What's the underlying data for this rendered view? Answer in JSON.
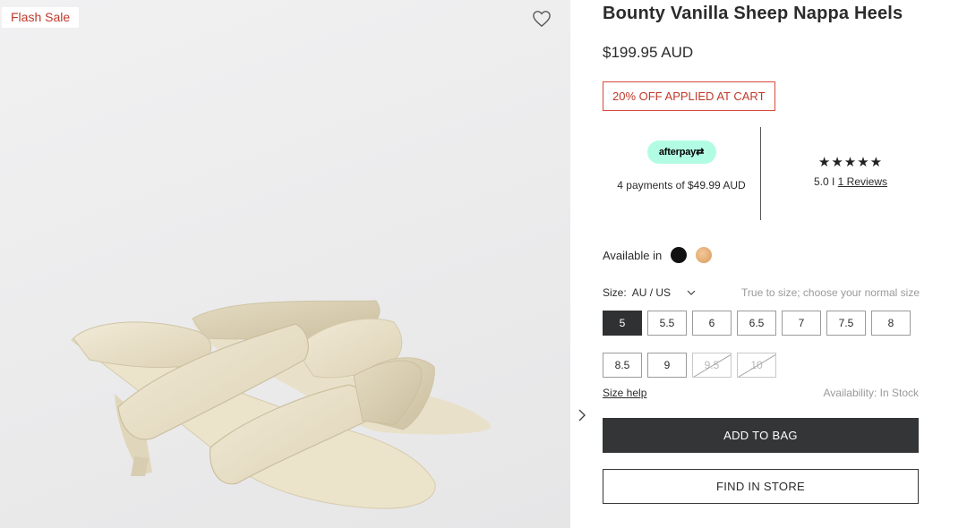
{
  "gallery": {
    "badge": "Flash Sale",
    "wishlist_icon": "heart-outline-icon",
    "next_icon": "chevron-right-icon"
  },
  "product": {
    "title": "Bounty Vanilla Sheep Nappa Heels",
    "price": "$199.95 AUD",
    "promo": "20% OFF APPLIED AT CART"
  },
  "afterpay": {
    "badge_label": "afterpay",
    "text": "4 payments of $49.99 AUD"
  },
  "reviews": {
    "stars": "★★★★★",
    "score": "5.0",
    "separator": " I ",
    "count_label": "1 Reviews"
  },
  "availability": {
    "label": "Available in",
    "colors": [
      "#111111",
      "#e7b07a"
    ]
  },
  "size": {
    "label": "Size:",
    "system": "AU / US",
    "hint": "True to size; choose your normal size",
    "options": [
      {
        "label": "5",
        "state": "selected"
      },
      {
        "label": "5.5",
        "state": "available"
      },
      {
        "label": "6",
        "state": "available"
      },
      {
        "label": "6.5",
        "state": "available"
      },
      {
        "label": "7",
        "state": "available"
      },
      {
        "label": "7.5",
        "state": "available"
      },
      {
        "label": "8",
        "state": "available"
      },
      {
        "label": "8.5",
        "state": "available"
      },
      {
        "label": "9",
        "state": "available"
      },
      {
        "label": "9.5",
        "state": "unavailable"
      },
      {
        "label": "10",
        "state": "unavailable"
      }
    ],
    "help_label": "Size help",
    "stock_label": "Availability: In Stock"
  },
  "actions": {
    "add_to_bag": "ADD TO BAG",
    "find_in_store": "FIND IN STORE"
  }
}
